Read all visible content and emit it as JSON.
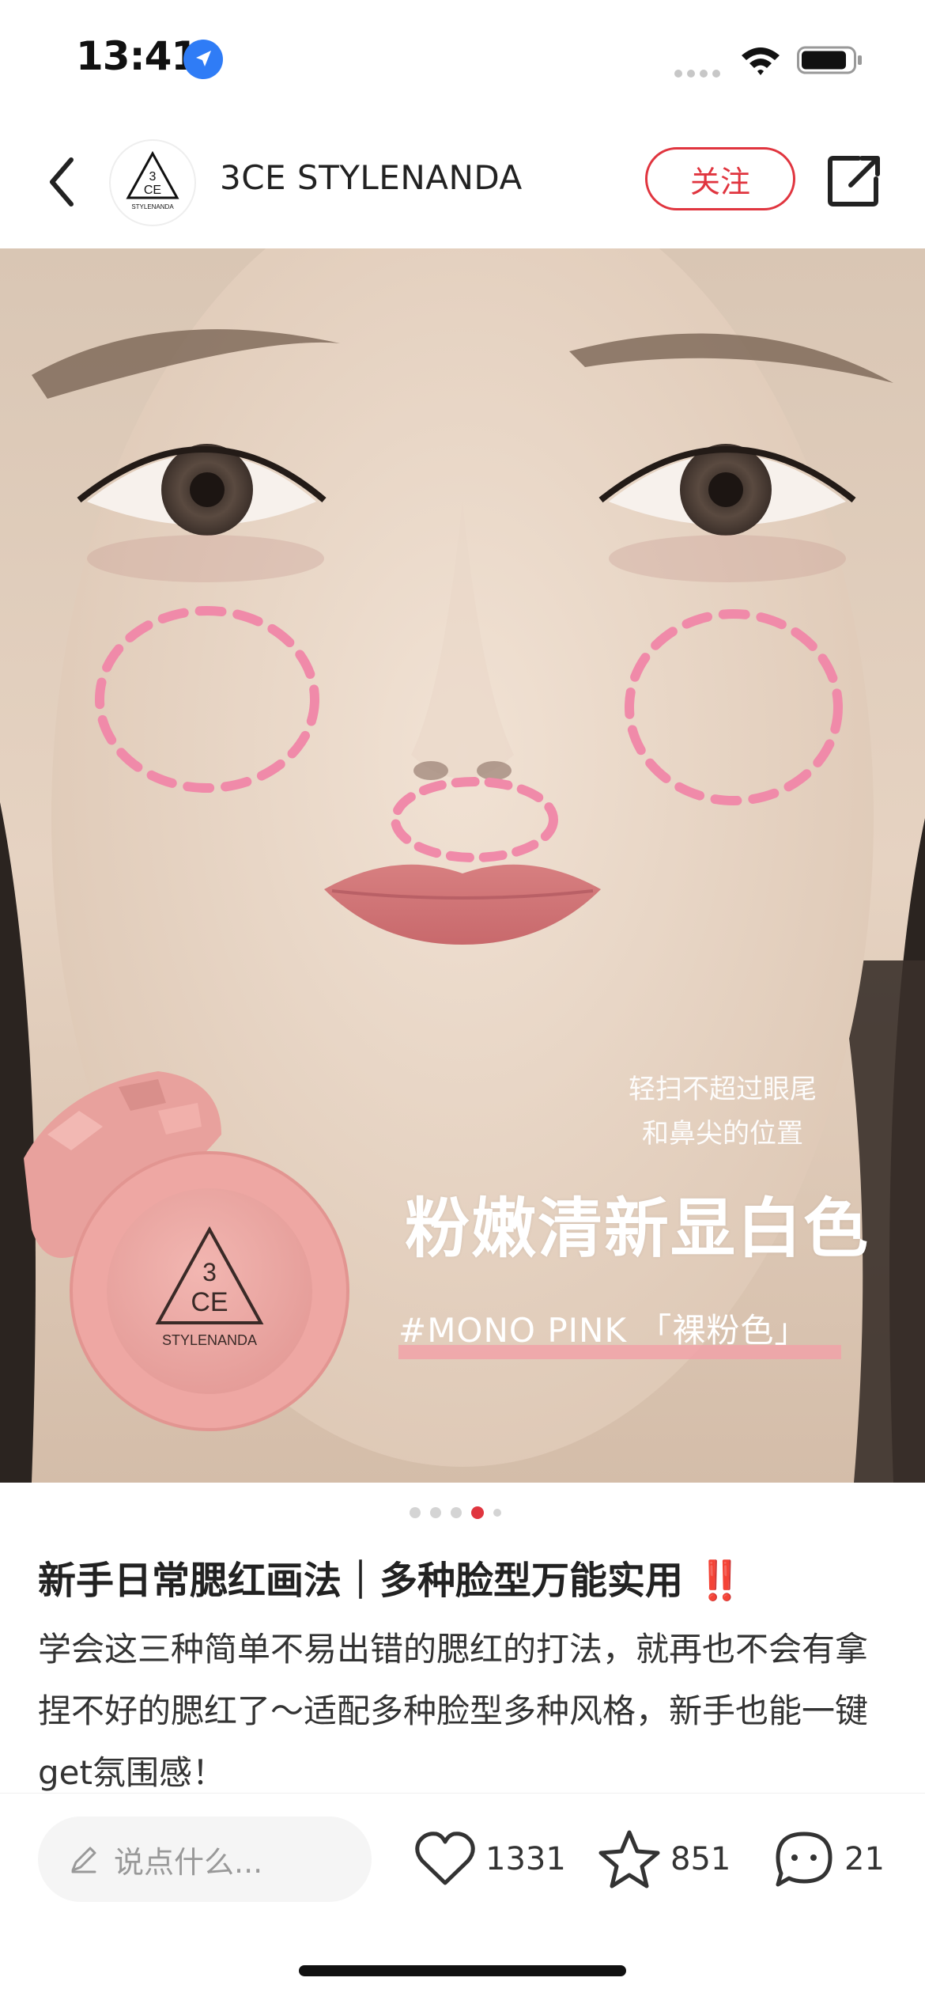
{
  "status_bar": {
    "time": "13:41"
  },
  "nav": {
    "brand_name": "3CE STYLENANDA",
    "logo_text_top": "3",
    "logo_text_mid": "CE",
    "logo_text_bottom": "STYLENANDA",
    "follow_label": "关注"
  },
  "hero": {
    "cheek_tip_line1": "轻扫不超过眼尾",
    "cheek_tip_line2": "和鼻尖的位置",
    "shade_title": "粉嫩清新显白色",
    "shade_tag": "#MONO PINK 「裸粉色」",
    "compact_logo_top": "3",
    "compact_logo_mid": "CE",
    "compact_logo_bottom": "STYLENANDA"
  },
  "carousel": {
    "total": 5,
    "active_index": 3
  },
  "post": {
    "title": "新手日常腮红画法｜多种脸型万能实用",
    "title_emoji": "‼️",
    "body": "学会这三种简单不易出错的腮红的打法，就再也不会有拿捏不好的腮红了～适配多种脸型多种风格，新手也能一键get氛围感！"
  },
  "bottom_bar": {
    "comment_placeholder": "说点什么...",
    "like_count": "1331",
    "favorite_count": "851",
    "comment_count": "21"
  },
  "colors": {
    "accent": "#e0353f",
    "blush_pink": "#f08aa9",
    "compact_pink": "#e9a1a0"
  }
}
